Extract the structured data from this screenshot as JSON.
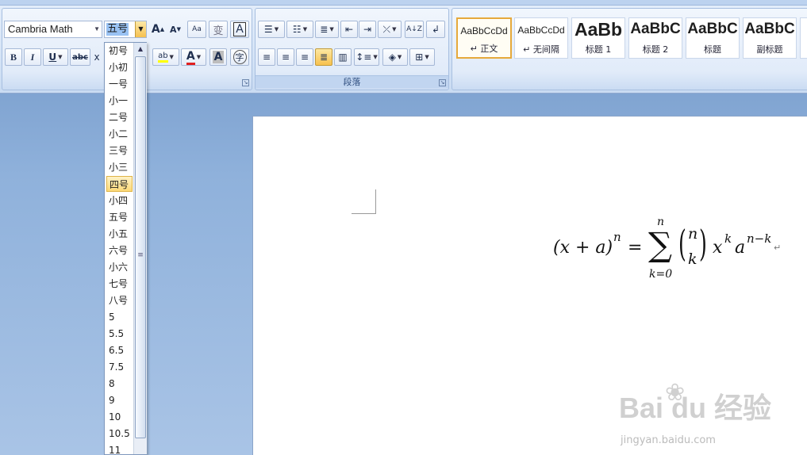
{
  "font": {
    "name": "Cambria Math",
    "size": "五号",
    "buttons": {
      "grow": "A",
      "shrink": "A",
      "clear_format": "Aa",
      "phonetic": "变",
      "border": "A",
      "bold": "B",
      "italic": "I",
      "underline": "U",
      "strike": "abc",
      "highlight": "ab",
      "color": "A",
      "shade": "A",
      "enclose": "字"
    }
  },
  "paragraph": {
    "group_label": "段落"
  },
  "styles": {
    "items": [
      {
        "sample": "AaBbCcDd",
        "name": "↵ 正文"
      },
      {
        "sample": "AaBbCcDd",
        "name": "↵ 无间隔"
      },
      {
        "sample": "AaBb",
        "name": "标题 1"
      },
      {
        "sample": "AaBbC",
        "name": "标题 2"
      },
      {
        "sample": "AaBbC",
        "name": "标题"
      },
      {
        "sample": "AaBbC",
        "name": "副标题"
      }
    ]
  },
  "size_options": [
    "初号",
    "小初",
    "一号",
    "小一",
    "二号",
    "小二",
    "三号",
    "小三",
    "四号",
    "小四",
    "五号",
    "小五",
    "六号",
    "小六",
    "七号",
    "八号",
    "5",
    "5.5",
    "6.5",
    "7.5",
    "8",
    "9",
    "10",
    "10.5",
    "11"
  ],
  "highlighted_size": "四号",
  "equation": {
    "lhs": "(x + a)",
    "lhs_exp": "n",
    "eq": "=",
    "sum": "∑",
    "sum_top": "n",
    "sum_bottom": "k=0",
    "binom_top": "n",
    "binom_bottom": "k",
    "x": "x",
    "x_exp": "k",
    "a": "a",
    "a_exp": "n−k",
    "para_mark": "↵"
  },
  "watermark": {
    "logo": "Bai  du 经验",
    "url": "jingyan.baidu.com"
  }
}
